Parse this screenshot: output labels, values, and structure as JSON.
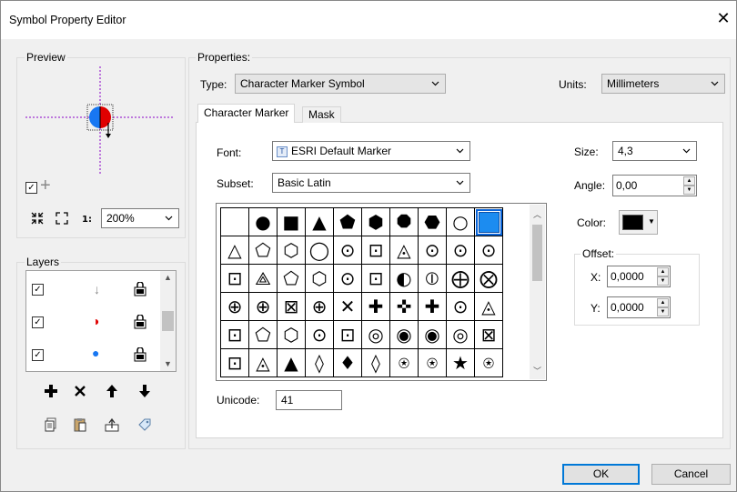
{
  "window": {
    "title": "Symbol Property Editor",
    "close_glyph": "✕"
  },
  "preview": {
    "group_label": "Preview",
    "zoom": {
      "value": "200%"
    },
    "add_glyph": "+"
  },
  "layers": {
    "group_label": "Layers",
    "rows": [
      {
        "checked": true,
        "symbol": "↓",
        "symbol_color": "#888888"
      },
      {
        "checked": true,
        "symbol": "◑",
        "symbol_color": "#e00000"
      },
      {
        "checked": true,
        "symbol": "●",
        "symbol_color": "#1877f2"
      }
    ]
  },
  "properties": {
    "group_label": "Properties:",
    "type_label": "Type:",
    "type_value": "Character Marker Symbol",
    "units_label": "Units:",
    "units_value": "Millimeters",
    "tabs": [
      {
        "label": "Character Marker",
        "active": true
      },
      {
        "label": "Mask",
        "active": false
      }
    ],
    "font_label": "Font:",
    "font_value": "ESRI Default Marker",
    "subset_label": "Subset:",
    "subset_value": "Basic Latin",
    "size_label": "Size:",
    "size_value": "4,3",
    "angle_label": "Angle:",
    "angle_value": "0,00",
    "color_label": "Color:",
    "color_value": "#000000",
    "offset_label": "Offset:",
    "x_label": "X:",
    "x_value": "0,0000",
    "y_label": "Y:",
    "y_value": "0,0000",
    "unicode_label": "Unicode:",
    "unicode_value": "41",
    "glyphs": [
      [
        "",
        "●",
        "■",
        "▲",
        "⬟",
        "⬢",
        "⯃",
        "⬣",
        "○",
        "SEL"
      ],
      [
        "△",
        "⬠",
        "⬡",
        "◯",
        "⊙",
        "⊡",
        "◬",
        "⊙",
        "⊙",
        "⊙"
      ],
      [
        "⊡",
        "⟁",
        "⬠",
        "⬡",
        "⊙",
        "⊡",
        "◐",
        "⦶",
        "⨁",
        "⨂"
      ],
      [
        "⊕",
        "⊕",
        "⊠",
        "⊕",
        "✕",
        "✚",
        "✜",
        "✚",
        "⊙",
        "◬"
      ],
      [
        "⊡",
        "⬠",
        "⬡",
        "⊙",
        "⊡",
        "◎",
        "◉",
        "◉",
        "◎",
        "⊠"
      ],
      [
        "⊡",
        "◬",
        "▲",
        "◊",
        "♦",
        "◊",
        "⍟",
        "⍟",
        "★",
        "⍟"
      ]
    ]
  },
  "buttons": {
    "ok": "OK",
    "cancel": "Cancel"
  },
  "colors": {
    "selection": "#1c8cf0",
    "accent": "#0078d7",
    "preview_red": "#e00000",
    "preview_blue": "#1877f2",
    "crosshair": "#8a00c8"
  }
}
